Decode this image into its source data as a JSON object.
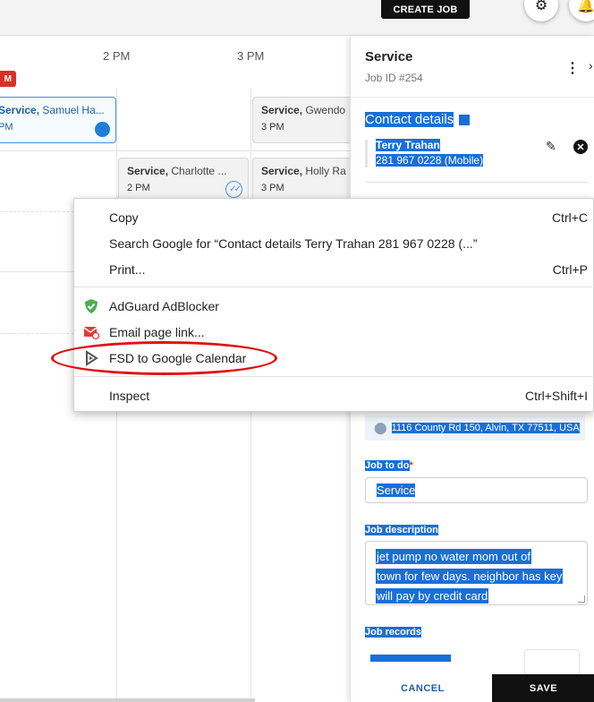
{
  "topbar": {
    "create_job_label": "CREATE JOB",
    "settings_icon": "gear-icon",
    "notifications_icon": "bell-icon"
  },
  "calendar": {
    "time_labels": [
      "2 PM",
      "3 PM"
    ],
    "events": [
      {
        "service": "Service,",
        "name": "Samuel Ha...",
        "time": "PM",
        "status": "blue-dot"
      },
      {
        "service": "Service,",
        "name": "Gwendo",
        "time": "3 PM"
      },
      {
        "service": "Service,",
        "name": "Charlotte ...",
        "time": "2 PM",
        "status": "double-check"
      },
      {
        "service": "Service,",
        "name": "Holly Ra",
        "time": "3 PM"
      }
    ]
  },
  "panel": {
    "title": "Service",
    "job_id": "Job ID #254",
    "contact_heading": "Contact details",
    "contact_name": "Terry Trahan",
    "contact_phone": "281 967 0228 (Mobile)",
    "address": "1116 County Rd 150, Alvin, TX 77511, USA",
    "job_to_do_label": "Job to do",
    "required_mark": "*",
    "job_to_do_value": "Service",
    "job_description_label": "Job description",
    "job_description_lines": [
      "jet pump no water  mom out of",
      "town for few days.  neighbor has key",
      "will pay by credit card"
    ],
    "job_records_label": "Job records",
    "cancel_label": "CANCEL",
    "save_label": "SAVE",
    "selection_color": "#1a6fd6"
  },
  "context_menu": {
    "items": [
      {
        "label": "Copy",
        "shortcut": "Ctrl+C"
      },
      {
        "label": "Search Google for “Contact details  Terry Trahan 281 967 0228 (...”",
        "shortcut": ""
      },
      {
        "label": "Print...",
        "shortcut": "Ctrl+P"
      },
      {
        "label": "AdGuard AdBlocker",
        "shortcut": "",
        "icon": "adguard-shield-icon"
      },
      {
        "label": "Email page link...",
        "shortcut": "",
        "icon": "email-icon"
      },
      {
        "label": "FSD to Google Calendar",
        "shortcut": "",
        "icon": "fsd-play-icon",
        "highlighted": true
      },
      {
        "label": "Inspect",
        "shortcut": "Ctrl+Shift+I"
      }
    ],
    "highlight_color": "#e01010"
  }
}
